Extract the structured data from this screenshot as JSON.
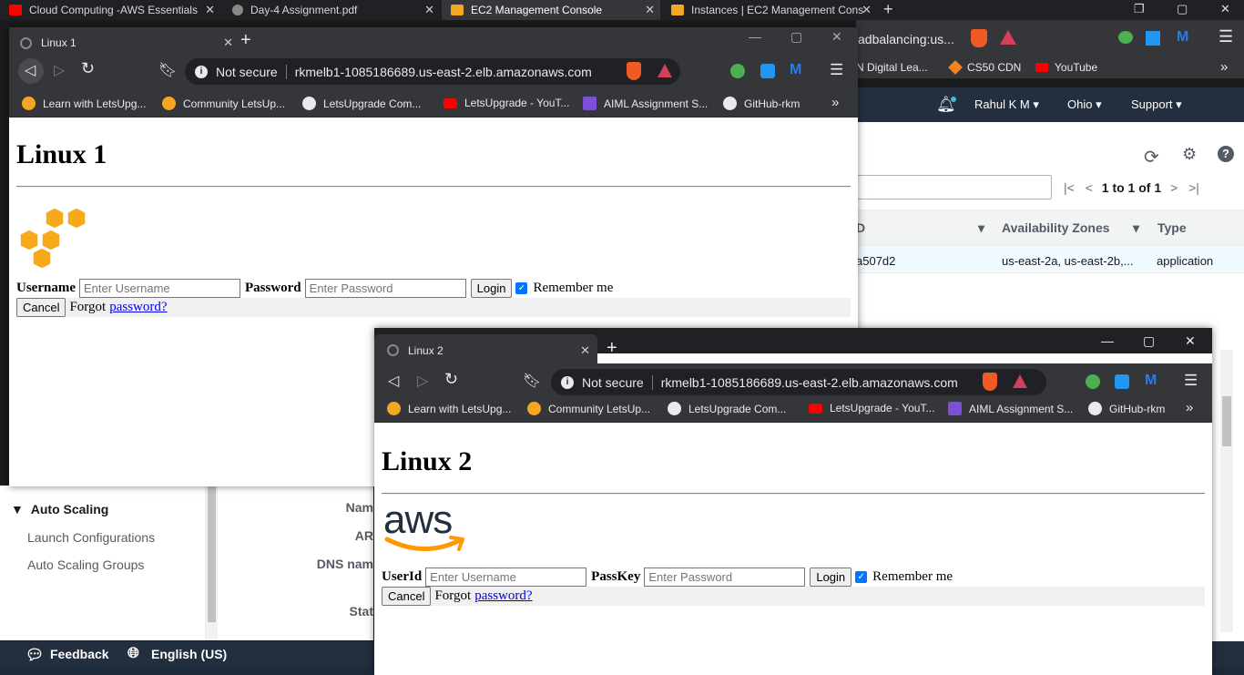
{
  "bg_browser": {
    "tabs": [
      {
        "label": "Cloud Computing -AWS Essentials",
        "icon": "youtube-icon",
        "color": "#ff0000"
      },
      {
        "label": "Day-4 Assignment.pdf",
        "icon": "globe-icon",
        "color": "#888888"
      },
      {
        "label": "EC2 Management Console",
        "icon": "aws-box-icon",
        "color": "#f5a623"
      },
      {
        "label": "Instances | EC2 Management Cons",
        "icon": "aws-box-icon",
        "color": "#f5a623"
      }
    ],
    "url_fragment": "adbalancing:us...",
    "bookmarks": [
      {
        "label": "N Digital Lea...",
        "icon": "book-icon"
      },
      {
        "label": "CS50 CDN",
        "icon": "cube-icon"
      },
      {
        "label": "YouTube",
        "icon": "youtube-icon"
      }
    ],
    "bookmarks_more": "»"
  },
  "aws": {
    "nav": {
      "user": "Rahul K M",
      "region": "Ohio",
      "support": "Support"
    },
    "pagination": {
      "text": "1 to 1 of 1"
    },
    "table": {
      "headers": [
        "D",
        "Availability Zones",
        "Type"
      ],
      "row": [
        "a507d2",
        "us-east-2a, us-east-2b,...",
        "application"
      ]
    },
    "sidebar": {
      "section": "Auto Scaling",
      "items": [
        "Launch Configurations",
        "Auto Scaling Groups"
      ]
    },
    "detail_labels": [
      "Nam",
      "AR",
      "DNS nam",
      "Stat"
    ],
    "footer": {
      "feedback": "Feedback",
      "language": "English (US)"
    }
  },
  "popup1": {
    "tab_title": "Linux 1",
    "not_secure": "Not secure",
    "url": "rkmelb1-1085186689.us-east-2.elb.amazonaws.com",
    "heading": "Linux 1",
    "user_label": "Username",
    "user_placeholder": "Enter Username",
    "pass_label": "Password",
    "pass_placeholder": "Enter Password",
    "login": "Login",
    "remember": "Remember me",
    "cancel": "Cancel",
    "forgot": "Forgot",
    "forgot_link": "password?"
  },
  "popup2": {
    "tab_title": "Linux 2",
    "not_secure": "Not secure",
    "url": "rkmelb1-1085186689.us-east-2.elb.amazonaws.com",
    "heading": "Linux 2",
    "logo_text": "aws",
    "user_label": "UserId",
    "user_placeholder": "Enter Username",
    "pass_label": "PassKey",
    "pass_placeholder": "Enter Password",
    "login": "Login",
    "remember": "Remember me",
    "cancel": "Cancel",
    "forgot": "Forgot",
    "forgot_link": "password?"
  },
  "popup_bookmarks": [
    {
      "label": "Learn with LetsUpg...",
      "icon": "letsupgrade-icon",
      "color": "#f5a623"
    },
    {
      "label": "Community LetsUp...",
      "icon": "letsupgrade-icon",
      "color": "#f5a623"
    },
    {
      "label": "LetsUpgrade Com...",
      "icon": "github-icon",
      "color": "#ffffff"
    },
    {
      "label": "LetsUpgrade - YouT...",
      "icon": "youtube-icon",
      "color": "#ff0000"
    },
    {
      "label": "AIML Assignment S...",
      "icon": "form-icon",
      "color": "#7b4fd6"
    },
    {
      "label": "GitHub-rkm",
      "icon": "github-icon",
      "color": "#ffffff"
    }
  ],
  "bookmarks_more": "»"
}
